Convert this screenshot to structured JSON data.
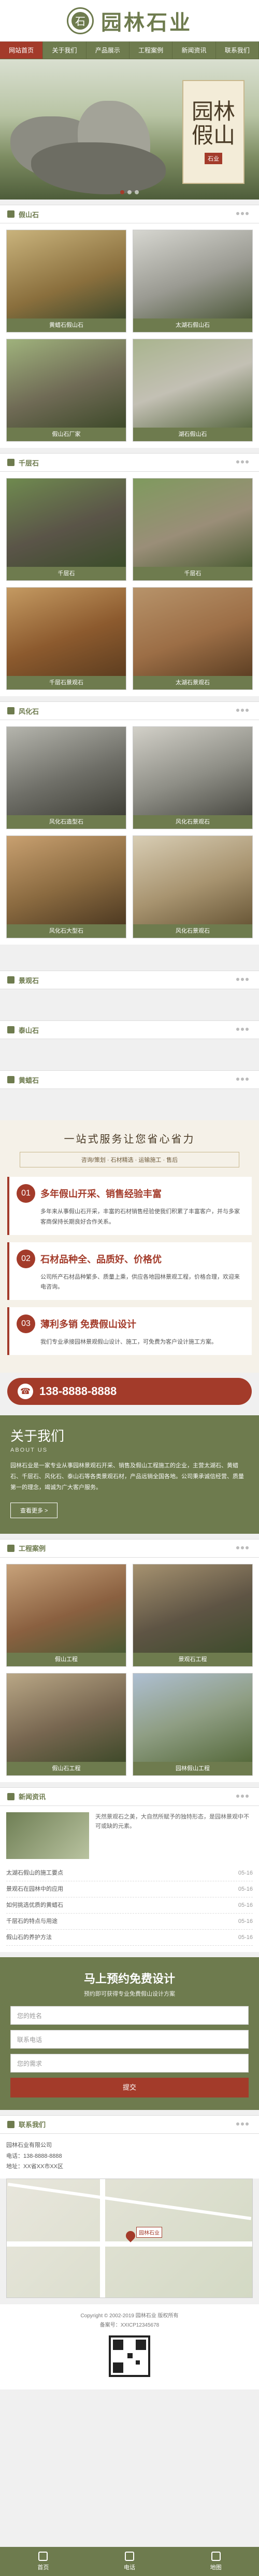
{
  "brand": {
    "name": "园林石业",
    "badge_char": "石"
  },
  "nav": [
    "网站首页",
    "关于我们",
    "产品展示",
    "工程案例",
    "新闻资讯",
    "联系我们"
  ],
  "banner": {
    "big_text": "园林\n假山",
    "stamp": "石业"
  },
  "sections": {
    "jiashan": {
      "title": "假山石",
      "items": [
        "黄蜡石假山石",
        "太湖石假山石",
        "假山石厂家",
        "湖石假山石"
      ]
    },
    "qianceng": {
      "title": "千层石",
      "items": [
        "千层石",
        "千层石",
        "千层石景观石",
        "太湖石景观石"
      ]
    },
    "fengshi": {
      "title": "风化石",
      "items": [
        "风化石造型石",
        "风化石景观石",
        "风化石大型石",
        "风化石景观石"
      ]
    },
    "empty1": {
      "title": "景观石"
    },
    "empty2": {
      "title": "泰山石"
    },
    "empty3": {
      "title": "黄蜡石"
    }
  },
  "service": {
    "head": "一站式服务让您省心省力",
    "sub": "咨询/策划 · 石材精选 · 运输施工 · 售后",
    "items": [
      {
        "num": "01",
        "title": "多年假山开采、销售经验丰富",
        "text": "多年来从事假山石开采，丰富的石材销售经验使我们积累了丰富客户，并与多家客商保持长期良好合作关系。"
      },
      {
        "num": "02",
        "title": "石材品种全、品质好、价格优",
        "text": "公司所产石材品种繁多、质量上乘，供应各地园林景观工程，价格合理，欢迎来电咨询。"
      },
      {
        "num": "03",
        "title": "薄利多销 免费假山设计",
        "text": "我们专业承接园林景观假山设计、施工，可免费为客户设计施工方案。"
      }
    ],
    "phone": "138-8888-8888"
  },
  "about": {
    "title": "关于我们",
    "en": "ABOUT US",
    "text": "园林石业是一家专业从事园林景观石开采、销售及假山工程施工的企业，主营太湖石、黄蜡石、千层石、风化石、泰山石等各类景观石材，产品远销全国各地。公司秉承诚信经营、质量第一的理念，竭诚为广大客户服务。",
    "more": "查看更多 >"
  },
  "cases": {
    "title": "工程案例",
    "items": [
      "假山工程",
      "景观石工程",
      "假山石工程",
      "园林假山工程"
    ]
  },
  "news": {
    "title": "新闻资讯",
    "top_text": "天然景观石之美，大自然所赋予的独特形态，是园林景观中不可或缺的元素。",
    "list": [
      {
        "t": "太湖石假山的施工要点",
        "d": "05-16"
      },
      {
        "t": "景观石在园林中的应用",
        "d": "05-16"
      },
      {
        "t": "如何挑选优质的黄蜡石",
        "d": "05-16"
      },
      {
        "t": "千层石的特点与用途",
        "d": "05-16"
      },
      {
        "t": "假山石的养护方法",
        "d": "05-16"
      }
    ]
  },
  "booking": {
    "title": "马上预约免费设计",
    "sub": "预约即可获得专业免费假山设计方案",
    "fields": [
      "您的姓名",
      "联系电话",
      "您的需求"
    ],
    "submit": "提交"
  },
  "contact": {
    "title": "联系我们",
    "company": "园林石业有限公司",
    "phone": "电话：138-8888-8888",
    "addr": "地址：XX省XX市XX区",
    "map_label": "园林石业"
  },
  "footer": {
    "copy": "Copyright © 2002-2019 园林石业 版权所有",
    "icp": "备案号：XXICP12345678"
  },
  "bottom_nav": [
    "首页",
    "电话",
    "地图"
  ]
}
